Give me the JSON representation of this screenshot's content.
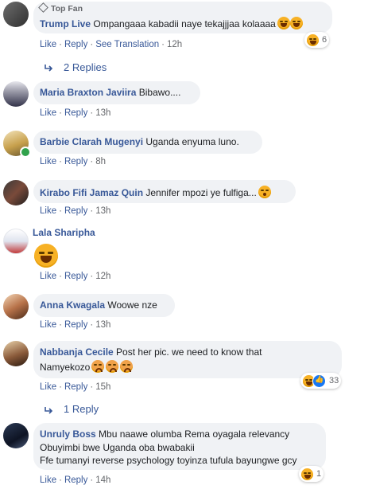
{
  "actions": {
    "like": "Like",
    "reply": "Reply",
    "see_translation": "See Translation",
    "sep": "·"
  },
  "comments": [
    {
      "badge": "Top Fan",
      "author": "Trump Live",
      "text": "Ompangaaa kabadii naye tekajjjaa kolaaaa",
      "time": "12h",
      "reaction_count": "6"
    },
    {
      "author": "Maria Braxton Javiira",
      "text": "Bibawo....",
      "time": "13h"
    },
    {
      "author": "Barbie Clarah Mugenyi",
      "text": "Uganda enyuma luno.",
      "time": "8h"
    },
    {
      "author": "Kirabo Fifi Jamaz Quin",
      "text": "Jennifer mpozi ye fulfiga...",
      "time": "13h"
    },
    {
      "author": "Lala Sharipha",
      "text": "",
      "time": "12h"
    },
    {
      "author": "Anna Kwagala",
      "text": "Woowe nze",
      "time": "13h"
    },
    {
      "author": "Nabbanja Cecile",
      "text": "Post her pic. we need to know that",
      "text2": "Namyekozo",
      "time": "15h",
      "reaction_count": "33"
    },
    {
      "author": "Unruly Boss",
      "text": "Mbu naawe olumba Rema oyagala relevancy",
      "text2": "Obuyimbi bwe Uganda oba bwabakii",
      "text3": "Ffe tumanyi reverse psychology toyinza tufula bayungwe gcy",
      "time": "14h",
      "reaction_count": "1"
    }
  ],
  "replies": [
    {
      "label": "2 Replies"
    },
    {
      "label": "1 Reply"
    }
  ],
  "colors": {
    "link": "#385898",
    "bubble": "#f0f2f5",
    "meta": "#65676b",
    "accent": "#1877f2"
  }
}
